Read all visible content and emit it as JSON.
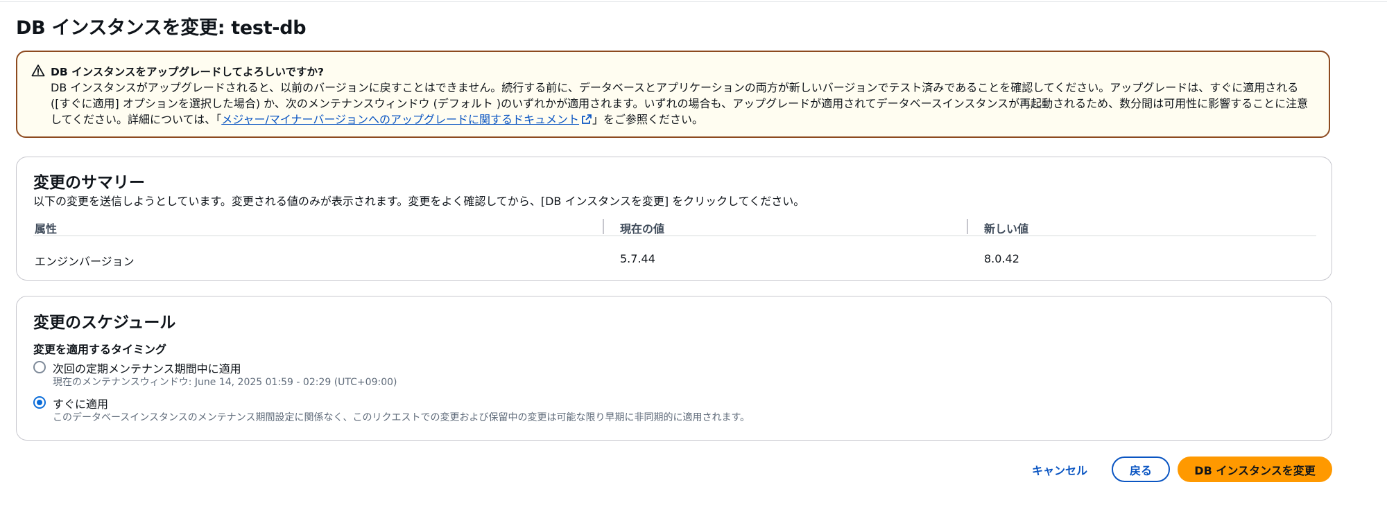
{
  "page": {
    "title": "DB インスタンスを変更: test-db"
  },
  "warning": {
    "icon": "warning-icon",
    "title": "DB インスタンスをアップグレードしてよろしいですか?",
    "body_before_link": "DB インスタンスがアップグレードされると、以前のバージョンに戻すことはできません。続行する前に、データベースとアプリケーションの両方が新しいバージョンでテスト済みであることを確認してください。アップグレードは、すぐに適用される ([すぐに適用] オプションを選択した場合) か、次のメンテナンスウィンドウ (デフォルト )のいずれかが適用されます。いずれの場合も、アップグレードが適用されてデータベースインスタンスが再起動されるため、数分間は可用性に影響することに注意してください。詳細については、「",
    "link_text": "メジャー/マイナーバージョンへのアップグレードに関するドキュメント",
    "body_after_link": "」をご参照ください。"
  },
  "summary": {
    "title": "変更のサマリー",
    "description": "以下の変更を送信しようとしています。変更される値のみが表示されます。変更をよく確認してから、[DB インスタンスを変更] をクリックしてください。",
    "columns": [
      "属性",
      "現在の値",
      "新しい値"
    ],
    "rows": [
      {
        "attribute": "エンジンバージョン",
        "current": "5.7.44",
        "new": "8.0.42"
      }
    ]
  },
  "schedule": {
    "title": "変更のスケジュール",
    "timing_label": "変更を適用するタイミング",
    "options": [
      {
        "label": "次回の定期メンテナンス期間中に適用",
        "hint": "現在のメンテナンスウィンドウ: June 14, 2025 01:59 - 02:29 (UTC+09:00)",
        "selected": false
      },
      {
        "label": "すぐに適用",
        "hint": "このデータベースインスタンスのメンテナンス期間設定に関係なく、このリクエストでの変更および保留中の変更は可能な限り早期に非同期的に適用されます。",
        "selected": true
      }
    ]
  },
  "actions": {
    "cancel": "キャンセル",
    "back": "戻る",
    "modify": "DB インスタンスを変更"
  },
  "colors": {
    "primary_button": "#ff9900",
    "link": "#0a55c2",
    "warning_border": "#8d4a1f",
    "warning_bg": "#fffdf1",
    "radio_selected": "#0a6cd9"
  }
}
